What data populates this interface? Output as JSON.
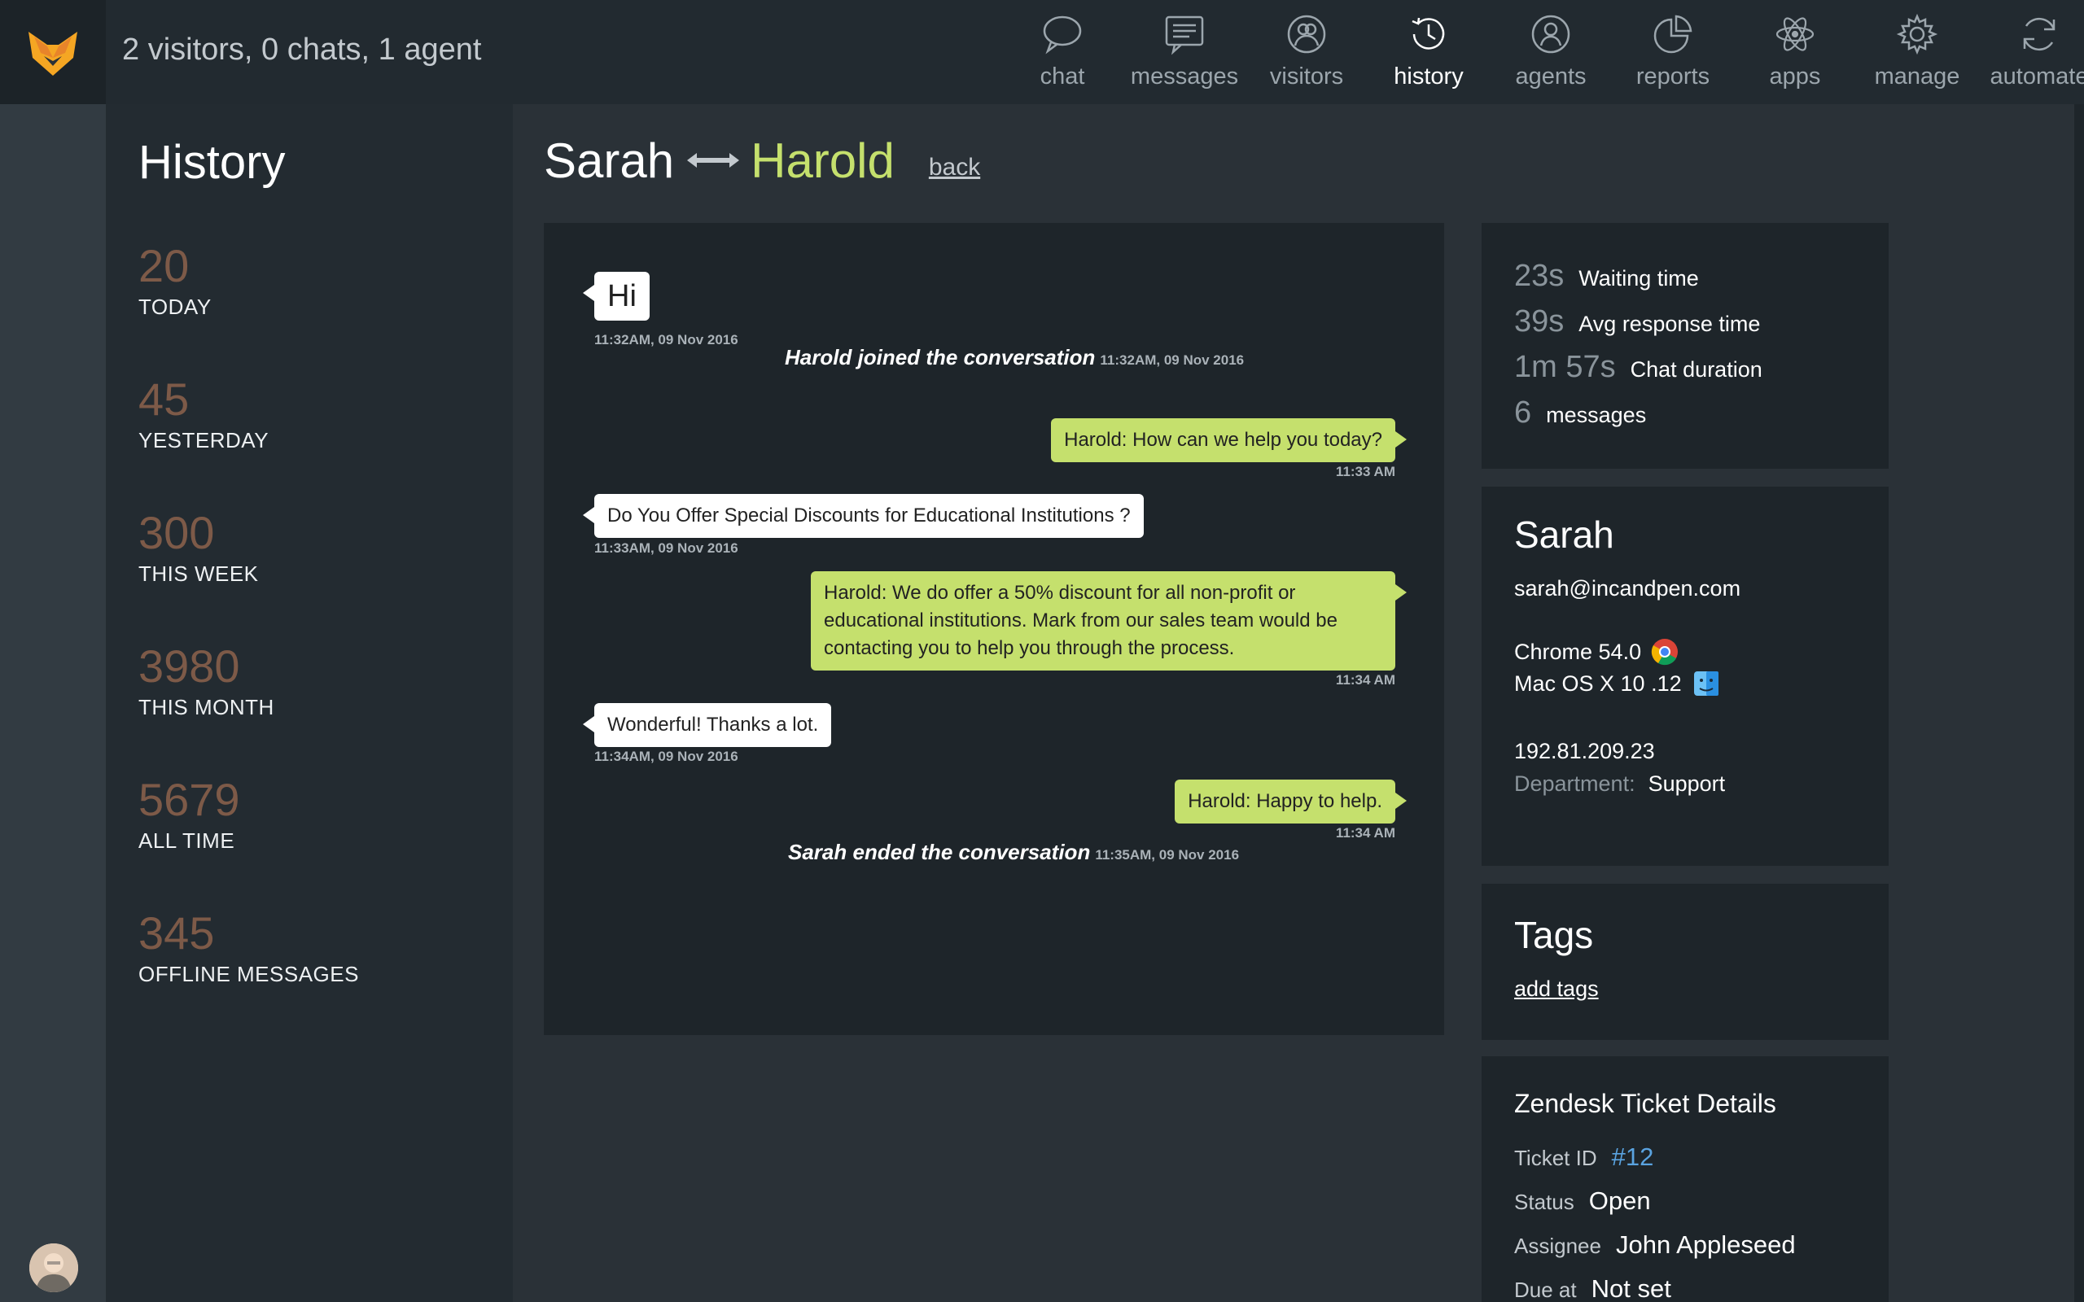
{
  "topbar": {
    "status_text": "2 visitors, 0 chats, 1 agent",
    "nav": [
      {
        "label": "chat",
        "icon": "chat-bubble-icon"
      },
      {
        "label": "messages",
        "icon": "messages-icon"
      },
      {
        "label": "visitors",
        "icon": "visitors-icon"
      },
      {
        "label": "history",
        "icon": "history-clock-icon",
        "active": true
      },
      {
        "label": "agents",
        "icon": "agents-icon"
      },
      {
        "label": "reports",
        "icon": "reports-pie-icon"
      },
      {
        "label": "apps",
        "icon": "apps-atom-icon"
      },
      {
        "label": "manage",
        "icon": "gear-icon"
      },
      {
        "label": "automate",
        "icon": "refresh-icon"
      }
    ]
  },
  "sidebar": {
    "title": "History",
    "stats": [
      {
        "value": "20",
        "label": "TODAY"
      },
      {
        "value": "45",
        "label": "YESTERDAY"
      },
      {
        "value": "300",
        "label": "THIS WEEK"
      },
      {
        "value": "3980",
        "label": "THIS MONTH"
      },
      {
        "value": "5679",
        "label": "ALL TIME"
      },
      {
        "value": "345",
        "label": "OFFLINE MESSAGES"
      }
    ]
  },
  "conversation": {
    "visitor": "Sarah",
    "agent": "Harold",
    "back_label": "back",
    "messages": [
      {
        "from": "visitor",
        "text": "Hi",
        "time": "11:32AM, 09 Nov 2016"
      },
      {
        "type": "event",
        "text": "Harold joined the conversation",
        "time": "11:32AM, 09 Nov 2016"
      },
      {
        "from": "agent",
        "text": "Harold: How can we help you today?",
        "time": "11:33 AM"
      },
      {
        "from": "visitor",
        "text": "Do You Offer Special Discounts for Educational Institutions ?",
        "time": "11:33AM, 09 Nov 2016"
      },
      {
        "from": "agent",
        "text": "Harold: We do offer a 50% discount for all non-profit or educational institutions. Mark from our sales team would be contacting you to help you through the process.",
        "time": "11:34 AM"
      },
      {
        "from": "visitor",
        "text": "Wonderful! Thanks a lot.",
        "time": "11:34AM, 09 Nov 2016"
      },
      {
        "from": "agent",
        "text": "Harold: Happy to help.",
        "time": "11:34 AM"
      },
      {
        "type": "event",
        "text": "Sarah ended the conversation",
        "time": "11:35AM, 09 Nov 2016"
      }
    ]
  },
  "metrics": [
    {
      "value": "23s",
      "label": "Waiting time"
    },
    {
      "value": "39s",
      "label": "Avg response time"
    },
    {
      "value": "1m 57s",
      "label": "Chat duration"
    },
    {
      "value": "6",
      "label": "messages"
    }
  ],
  "visitor_info": {
    "name": "Sarah",
    "email": "sarah@incandpen.com",
    "browser": "Chrome 54.0",
    "browser_icon": "chrome-icon",
    "os": "Mac OS X 10 .12",
    "os_icon": "finder-icon",
    "ip": "192.81.209.23",
    "department_label": "Department:",
    "department": "Support"
  },
  "tags": {
    "title": "Tags",
    "add_label": "add tags"
  },
  "zendesk": {
    "title": "Zendesk Ticket Details",
    "rows": [
      {
        "key": "Ticket ID",
        "value": "#12"
      },
      {
        "key": "Status",
        "value": "Open"
      },
      {
        "key": "Assignee",
        "value": "John Appleseed"
      },
      {
        "key": "Due at",
        "value": "Not set"
      }
    ]
  },
  "colors": {
    "accent_green": "#c5e06d",
    "stat_brown": "#7d5a48",
    "link_blue": "#5aa3e0",
    "logo_orange": "#f5a623"
  }
}
